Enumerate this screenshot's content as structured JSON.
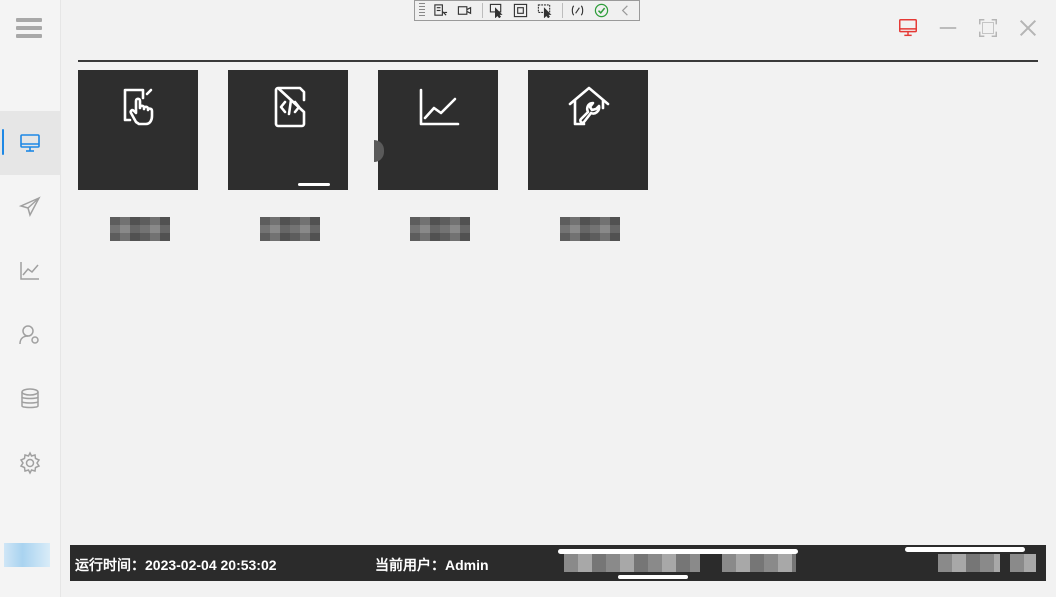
{
  "sidebar": {
    "menu_icon": "hamburger-icon",
    "items": [
      {
        "id": "monitor",
        "icon": "monitor-icon",
        "active": true
      },
      {
        "id": "send",
        "icon": "paper-plane-icon",
        "active": false
      },
      {
        "id": "chart",
        "icon": "line-chart-icon",
        "active": false
      },
      {
        "id": "user",
        "icon": "user-settings-icon",
        "active": false
      },
      {
        "id": "database",
        "icon": "database-icon",
        "active": false
      },
      {
        "id": "settings",
        "icon": "gear-icon",
        "active": false
      }
    ]
  },
  "debug_toolbar": {
    "buttons": [
      "select-element-icon",
      "video-icon",
      "pointer-select-icon",
      "frame-icon",
      "layout-pointer-icon",
      "binding-icon",
      "check-icon",
      "collapse-icon"
    ]
  },
  "window_controls": {
    "monitor_icon": "monitor-icon",
    "minimize_icon": "minimize-icon",
    "maximize_icon": "maximize-icon",
    "close_icon": "close-icon"
  },
  "tiles": [
    {
      "icon": "touch-hand-icon",
      "label": ""
    },
    {
      "icon": "code-file-icon",
      "label": ""
    },
    {
      "icon": "line-chart-icon",
      "label": ""
    },
    {
      "icon": "home-wrench-icon",
      "label": ""
    }
  ],
  "status": {
    "runtime_label": "运行时间：",
    "runtime_value": "2023-02-04 20:53:02",
    "user_label": "当前用户：",
    "user_value": "Admin"
  },
  "colors": {
    "accent": "#1e88e5",
    "alert_red": "#e53935",
    "tile_bg": "#2e2e2e",
    "status_bg": "#2b2b2b"
  }
}
